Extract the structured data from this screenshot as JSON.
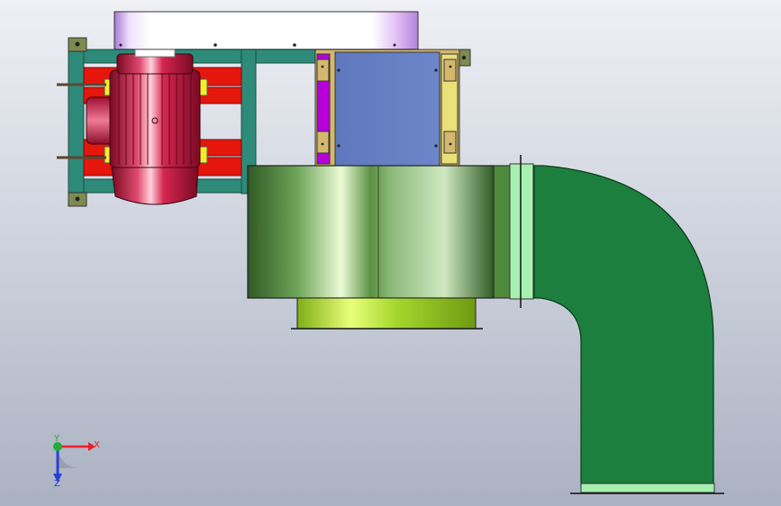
{
  "viewport": {
    "background_top": "#eef0f4",
    "background_bottom": "#aab1c1"
  },
  "triad": {
    "x_label": "X",
    "y_label": "Y",
    "z_label": "Z",
    "x_color": "#e8202a",
    "y_color": "#1fae3a",
    "z_color": "#2a3fd6"
  },
  "model": {
    "icons": [
      "electric-motor",
      "base-frame",
      "blower-housing",
      "blower-inlet-ring",
      "duct-elbow",
      "transition-duct",
      "guard-cover"
    ],
    "colors": {
      "frame": "#2e8a79",
      "motor": "#c2163e",
      "rail": "#e5160c",
      "blower": "#4f8a3c",
      "inlet": "#b6e632",
      "duct": "#1d7f3d",
      "flange": "#a6f0b0",
      "transition": "#6d86c9",
      "cover": "#b583dd"
    }
  }
}
